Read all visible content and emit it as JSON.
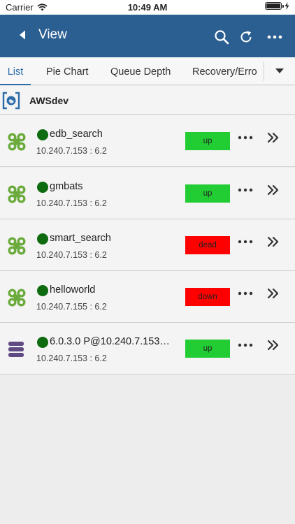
{
  "status_bar": {
    "carrier": "Carrier",
    "time": "10:49 AM"
  },
  "nav": {
    "title": "View"
  },
  "tabs": [
    {
      "label": "List"
    },
    {
      "label": "Pie Chart"
    },
    {
      "label": "Queue Depth"
    },
    {
      "label": "Recovery/Erro"
    }
  ],
  "group": {
    "title": "AWSdev"
  },
  "rows": [
    {
      "name": "edb_search",
      "detail": "10.240.7.153 : 6.2",
      "status": "up",
      "icon": "cluster-icon"
    },
    {
      "name": "gmbats",
      "detail": "10.240.7.153 : 6.2",
      "status": "up",
      "icon": "cluster-icon"
    },
    {
      "name": "smart_search",
      "detail": "10.240.7.153 : 6.2",
      "status": "dead",
      "icon": "cluster-icon"
    },
    {
      "name": "helloworld",
      "detail": "10.240.7.155 : 6.2",
      "status": "down",
      "icon": "cluster-icon"
    },
    {
      "name": "6.0.3.0 P@10.240.7.153…",
      "detail": "10.240.7.153 : 6.2",
      "status": "up",
      "icon": "server-stack-icon"
    }
  ],
  "colors": {
    "nav_bar": "#2c5f91",
    "accent": "#2c6ca8",
    "status_up": "#22cc33",
    "status_down": "#ff0000",
    "status_dot": "#0e6b10",
    "cluster_icon": "#6aab3c",
    "server_icon": "#5f4a84"
  }
}
